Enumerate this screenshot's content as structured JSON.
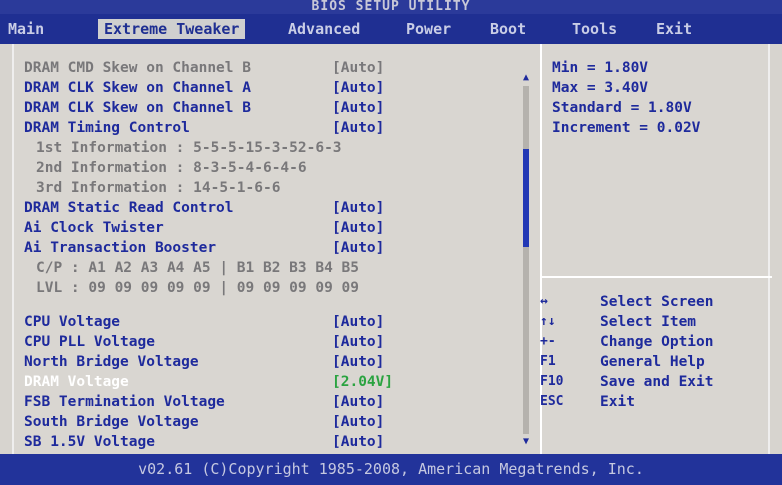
{
  "title": "BIOS SETUP UTILITY",
  "menu": [
    {
      "label": "Main",
      "active": false
    },
    {
      "label": "Extreme Tweaker",
      "active": true
    },
    {
      "label": "Advanced",
      "active": false
    },
    {
      "label": "Power",
      "active": false
    },
    {
      "label": "Boot",
      "active": false
    },
    {
      "label": "Tools",
      "active": false
    },
    {
      "label": "Exit",
      "active": false
    }
  ],
  "settings": [
    {
      "label": "DRAM CMD Skew on Channel B",
      "value": "[Auto]",
      "style": "grey"
    },
    {
      "label": "DRAM CLK Skew on Channel A",
      "value": "[Auto]",
      "style": "blue"
    },
    {
      "label": "DRAM CLK Skew on Channel B",
      "value": "[Auto]",
      "style": "blue"
    },
    {
      "label": "DRAM Timing Control",
      "value": "[Auto]",
      "style": "blue"
    },
    {
      "label": "1st Information : 5-5-5-15-3-52-6-3",
      "value": "",
      "style": "grey-info"
    },
    {
      "label": "2nd Information : 8-3-5-4-6-4-6",
      "value": "",
      "style": "grey-info"
    },
    {
      "label": "3rd Information : 14-5-1-6-6",
      "value": "",
      "style": "grey-info"
    },
    {
      "label": "DRAM Static Read Control",
      "value": "[Auto]",
      "style": "blue"
    },
    {
      "label": "Ai Clock Twister",
      "value": "[Auto]",
      "style": "blue"
    },
    {
      "label": "Ai Transaction Booster",
      "value": "[Auto]",
      "style": "blue"
    },
    {
      "label": "C/P : A1 A2 A3 A4 A5 | B1 B2 B3 B4 B5",
      "value": "",
      "style": "grey-info"
    },
    {
      "label": "LVL : 09 09 09 09 09 | 09 09 09 09 09",
      "value": "",
      "style": "grey-info"
    },
    {
      "label": "CPU Voltage",
      "value": "[Auto]",
      "style": "blue"
    },
    {
      "label": "CPU PLL Voltage",
      "value": "[Auto]",
      "style": "blue"
    },
    {
      "label": "North Bridge Voltage",
      "value": "[Auto]",
      "style": "blue"
    },
    {
      "label": "DRAM Voltage",
      "value": "[2.04V]",
      "style": "selected"
    },
    {
      "label": "FSB Termination Voltage",
      "value": "[Auto]",
      "style": "blue"
    },
    {
      "label": "South Bridge Voltage",
      "value": "[Auto]",
      "style": "blue"
    },
    {
      "label": "SB 1.5V Voltage",
      "value": "[Auto]",
      "style": "blue"
    }
  ],
  "help": [
    "Min = 1.80V",
    "Max = 3.40V",
    "Standard  = 1.80V",
    "Increment = 0.02V"
  ],
  "keys": [
    {
      "key": "↔",
      "action": "Select Screen"
    },
    {
      "key": "↑↓",
      "action": "Select Item"
    },
    {
      "key": "+-",
      "action": "Change Option"
    },
    {
      "key": "F1",
      "action": "General Help"
    },
    {
      "key": "F10",
      "action": "Save and Exit"
    },
    {
      "key": "ESC",
      "action": "Exit"
    }
  ],
  "scroll_position": 0.25,
  "footer": "v02.61 (C)Copyright 1985-2008, American Megatrends, Inc."
}
